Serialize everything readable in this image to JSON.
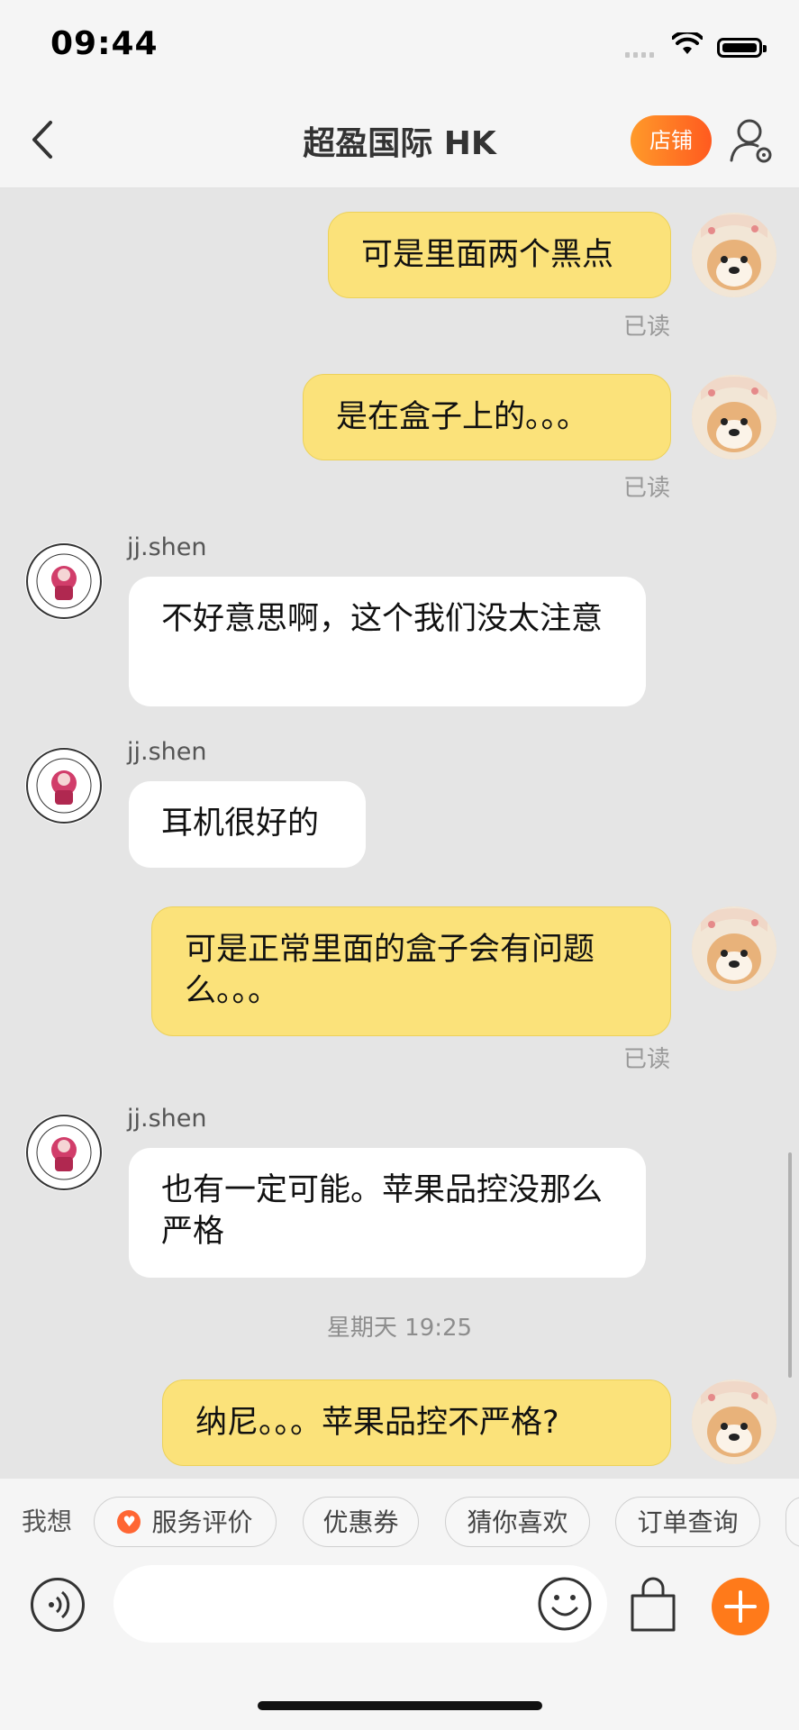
{
  "status_bar": {
    "time": "09:44"
  },
  "header": {
    "title": "超盈国际 HK",
    "shop_label": "店铺"
  },
  "messages": [
    {
      "type": "mine",
      "text": "可是里面两个黑点",
      "read": "已读"
    },
    {
      "type": "mine",
      "text": "是在盒子上的。。。",
      "read": "已读"
    },
    {
      "type": "theirs",
      "sender": "jj.shen",
      "text": "不好意思啊，这个我们没太注意"
    },
    {
      "type": "theirs",
      "sender": "jj.shen",
      "text": "耳机很好的"
    },
    {
      "type": "mine",
      "text": "可是正常里面的盒子会有问题么。。。",
      "read": "已读"
    },
    {
      "type": "theirs",
      "sender": "jj.shen",
      "text": "也有一定可能。苹果品控没那么严格"
    },
    {
      "type": "timestamp",
      "text": "星期天 19:25"
    },
    {
      "type": "mine",
      "text": "纳尼。。。苹果品控不严格?"
    }
  ],
  "quick_bar": {
    "label": "我想",
    "chips": [
      "服务评价",
      "优惠券",
      "猜你喜欢",
      "订单查询"
    ]
  },
  "colors": {
    "accent": "#ff7a1a",
    "my_bubble": "#fbe27a",
    "their_bubble": "#ffffff"
  }
}
